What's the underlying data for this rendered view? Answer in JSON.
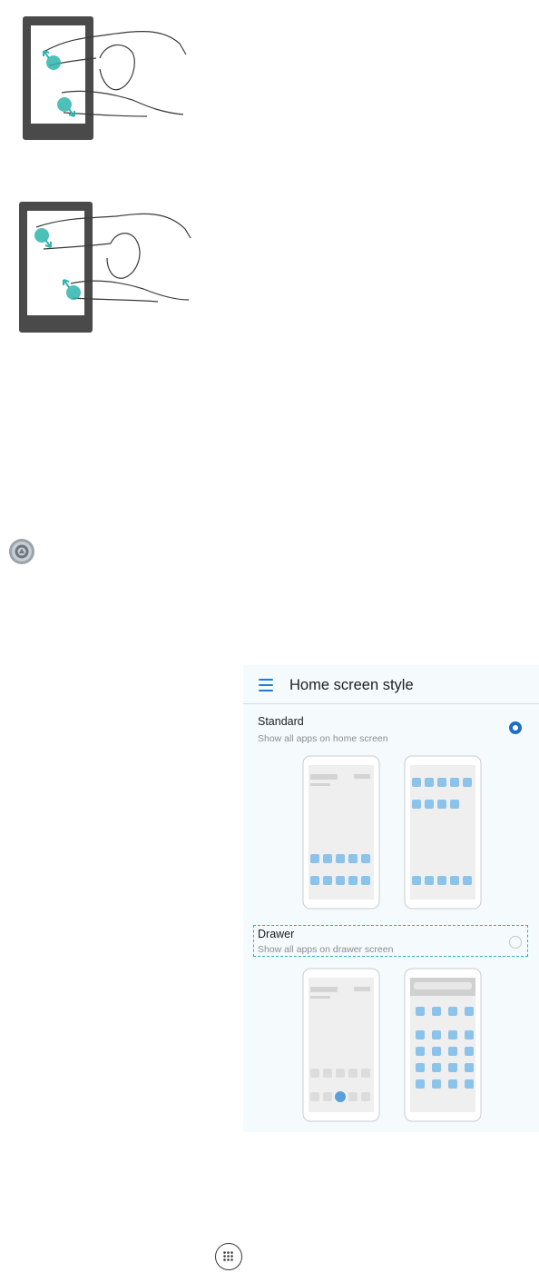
{
  "illustrations": {
    "pinch_out": {
      "icon": "two-finger-spread-gesture"
    },
    "pinch_in": {
      "icon": "two-finger-pinch-gesture"
    }
  },
  "settings_icon": {
    "icon": "settings-gear-icon"
  },
  "screenshot": {
    "header": {
      "title": "Home screen style",
      "menu_icon": "hamburger-menu-icon"
    },
    "options": [
      {
        "title": "Standard",
        "subtitle": "Show all apps on home screen",
        "selected": true
      },
      {
        "title": "Drawer",
        "subtitle": "Show all apps on drawer screen",
        "selected": false
      }
    ]
  },
  "app_drawer_icon": {
    "icon": "app-drawer-dots-icon"
  },
  "colors": {
    "accent": "#1e6fc4",
    "teal": "#2eb5ad",
    "icon_blue": "#8cc3ea",
    "frame_dark": "#4a4a4a"
  }
}
